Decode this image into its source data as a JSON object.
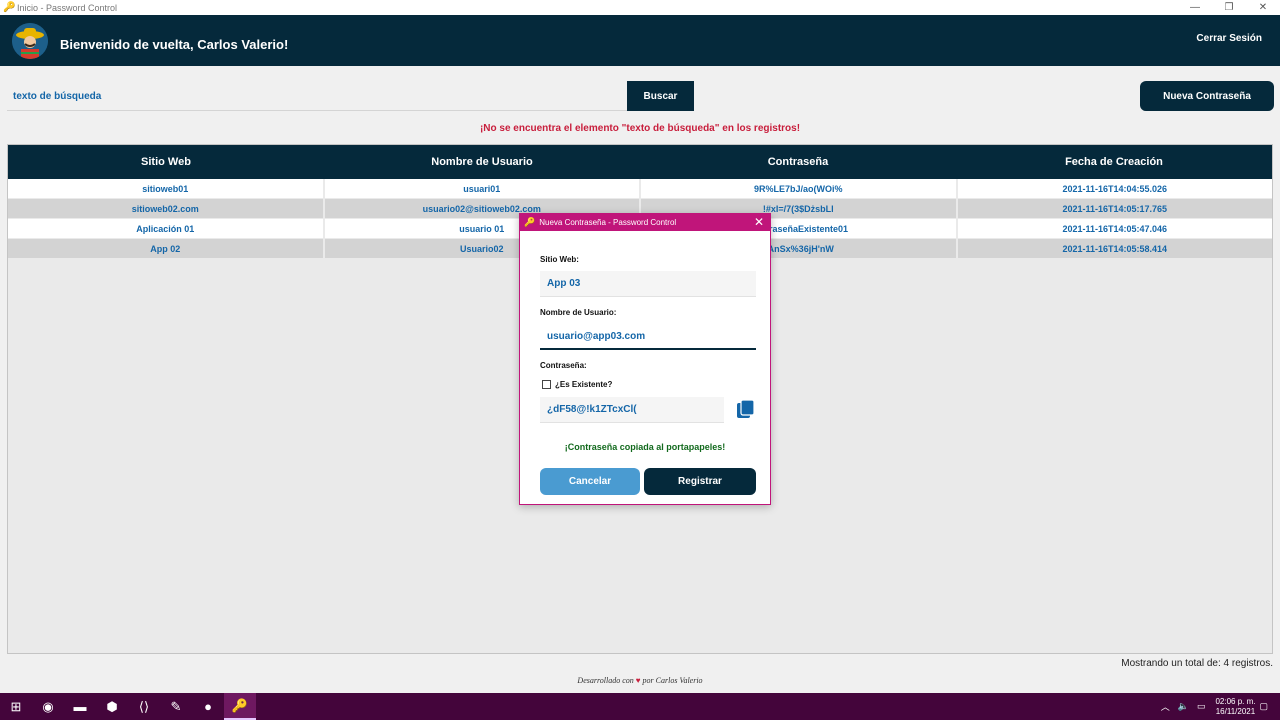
{
  "window": {
    "title": "Inicio - Password Control",
    "controls": [
      "—",
      "❐",
      "✕"
    ]
  },
  "header": {
    "welcome": "Bienvenido de vuelta, Carlos Valerio!",
    "logout": "Cerrar Sesión"
  },
  "search": {
    "value": "texto de búsqueda",
    "button": "Buscar",
    "new_button": "Nueva Contraseña",
    "error": "¡No se encuentra el elemento \"texto de búsqueda\" en los registros!"
  },
  "table": {
    "columns": [
      "Sitio Web",
      "Nombre de Usuario",
      "Contraseña",
      "Fecha de Creación"
    ],
    "rows": [
      [
        "sitioweb01",
        "usuari01",
        "9R%LE7bJ/ao(WOi%",
        "2021-11-16T14:04:55.026"
      ],
      [
        "sitioweb02.com",
        "usuario02@sitioweb02.com",
        "!#xI=/7(3$DżsbLl",
        "2021-11-16T14:05:17.765"
      ],
      [
        "Aplicación 01",
        "usuario 01",
        "ContraseñaExistente01",
        "2021-11-16T14:05:47.046"
      ],
      [
        "App 02",
        "Usuario02",
        "yAnSx%36jH'nW",
        "2021-11-16T14:05:58.414"
      ]
    ]
  },
  "total": "Mostrando un total de: 4 registros.",
  "footer": {
    "prefix": "Desarrollado con",
    "suffix": "por Carlos Valerio"
  },
  "modal": {
    "title": "Nueva Contraseña - Password Control",
    "site_label": "Sitio Web:",
    "site_value": "App 03",
    "user_label": "Nombre de Usuario:",
    "user_value": "usuario@app03.com",
    "pass_label": "Contraseña:",
    "existing_label": "¿Es Existente?",
    "pass_value": "¿dF58@!k1ZTcxCl(",
    "copied_msg": "¡Contraseña copiada al portapapeles!",
    "cancel": "Cancelar",
    "register": "Registrar"
  },
  "taskbar": {
    "time": "02:06 p. m.",
    "date": "16/11/2021"
  },
  "colors": {
    "header": "#05293b",
    "accent": "#c0157a",
    "link": "#1466a8",
    "error": "#c81e3c",
    "success": "#136a1e",
    "taskbar": "#44053b"
  }
}
